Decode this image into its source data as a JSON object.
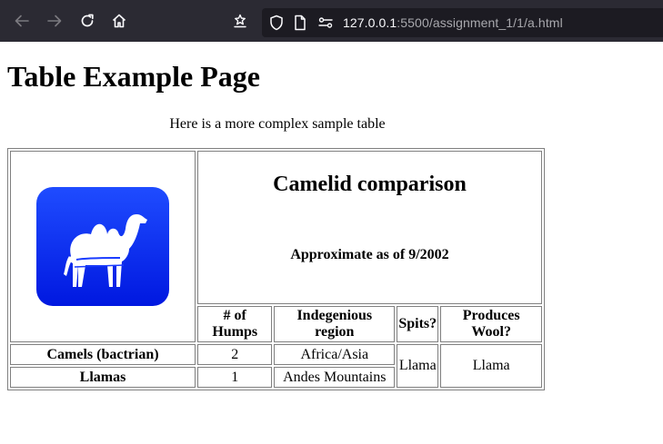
{
  "browser": {
    "url_host": "127.0.0.1",
    "url_path": ":5500/assignment_1/1/a.html",
    "icons": [
      "back-arrow-icon",
      "forward-arrow-icon",
      "reload-icon",
      "home-icon",
      "extension-icon",
      "shield-icon",
      "page-icon",
      "permissions-icon"
    ]
  },
  "page": {
    "title": "Table Example Page",
    "caption": "Here is a more complex sample table"
  },
  "table": {
    "heading": "Camelid comparison",
    "subheading": "Approximate as of 9/2002",
    "logo_icon": "camel-icon",
    "logo_color": "#0a2cf0",
    "columns": [
      "# of Humps",
      "Indegenious region",
      "Spits?",
      "Produces Wool?"
    ],
    "rows": [
      {
        "name": "Camels (bactrian)",
        "humps": "2",
        "region": "Africa/Asia"
      },
      {
        "name": "Llamas",
        "humps": "1",
        "region": "Andes Mountains"
      }
    ],
    "spits": "Llama",
    "produces_wool": "Llama"
  }
}
